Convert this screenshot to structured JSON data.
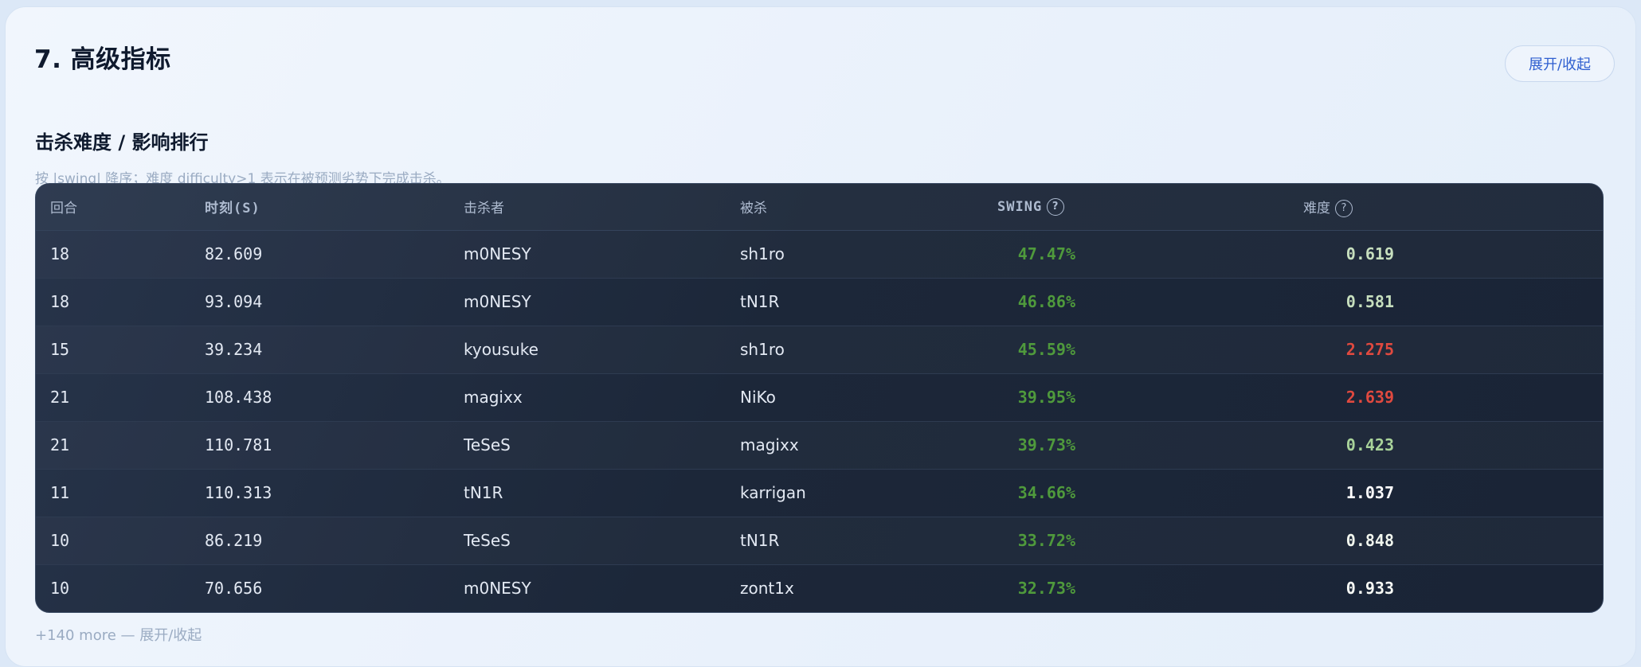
{
  "section": {
    "title": "7. 高级指标",
    "toggle_label": "展开/收起"
  },
  "kill_table": {
    "title": "击杀难度 / 影响排行",
    "hint": "按 |swing| 降序；难度 difficulty>1 表示在被预测劣势下完成击杀。",
    "columns": {
      "round": "回合",
      "time": "时刻(S)",
      "killer": "击杀者",
      "victim": "被杀",
      "swing": "SWING",
      "difficulty": "难度",
      "help_glyph": "?"
    },
    "rows": [
      {
        "round": "18",
        "time": "82.609",
        "killer": "m0NESY",
        "victim": "sh1ro",
        "swing": "47.47%",
        "difficulty": "0.619",
        "difficulty_color": "#c7dfbe"
      },
      {
        "round": "18",
        "time": "93.094",
        "killer": "m0NESY",
        "victim": "tN1R",
        "swing": "46.86%",
        "difficulty": "0.581",
        "difficulty_color": "#c7dfbe"
      },
      {
        "round": "15",
        "time": "39.234",
        "killer": "kyousuke",
        "victim": "sh1ro",
        "swing": "45.59%",
        "difficulty": "2.275",
        "difficulty_color": "#e0493f"
      },
      {
        "round": "21",
        "time": "108.438",
        "killer": "magixx",
        "victim": "NiKo",
        "swing": "39.95%",
        "difficulty": "2.639",
        "difficulty_color": "#e0493f"
      },
      {
        "round": "21",
        "time": "110.781",
        "killer": "TeSeS",
        "victim": "magixx",
        "swing": "39.73%",
        "difficulty": "0.423",
        "difficulty_color": "#a9d39a"
      },
      {
        "round": "11",
        "time": "110.313",
        "killer": "tN1R",
        "victim": "karrigan",
        "swing": "34.66%",
        "difficulty": "1.037",
        "difficulty_color": "#ffffff"
      },
      {
        "round": "10",
        "time": "86.219",
        "killer": "TeSeS",
        "victim": "tN1R",
        "swing": "33.72%",
        "difficulty": "0.848",
        "difficulty_color": "#f1f6ee"
      },
      {
        "round": "10",
        "time": "70.656",
        "killer": "m0NESY",
        "victim": "zont1x",
        "swing": "32.73%",
        "difficulty": "0.933",
        "difficulty_color": "#f7faf5"
      }
    ],
    "more_text": "+140 more — 展开/收起"
  },
  "colors": {
    "swing_positive": "#4f9a3c",
    "accent": "#2f5fd0"
  }
}
